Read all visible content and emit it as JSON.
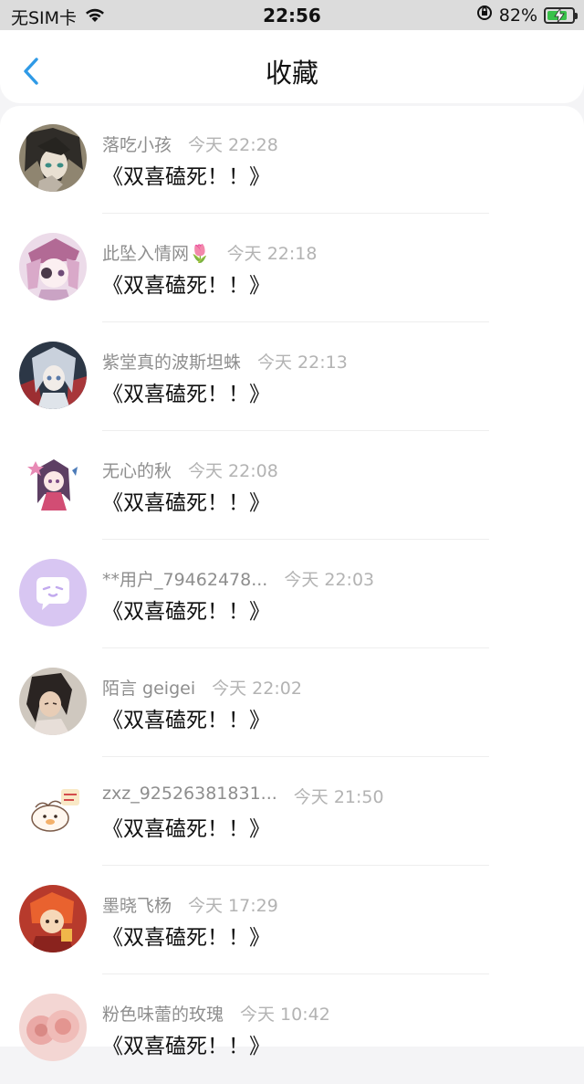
{
  "status_bar": {
    "carrier": "无SIM卡",
    "time": "22:56",
    "battery": "82%",
    "battery_level": 0.82
  },
  "nav": {
    "title": "收藏"
  },
  "items": [
    {
      "name": "落吃小孩",
      "time": "今天 22:28",
      "comment": "《双喜磕死！！》"
    },
    {
      "name": "此坠入情网🌷",
      "time": "今天 22:18",
      "comment": "《双喜磕死！！》"
    },
    {
      "name": "紫堂真的波斯坦蛛",
      "time": "今天 22:13",
      "comment": "《双喜磕死！！》"
    },
    {
      "name": "无心的秋",
      "time": "今天 22:08",
      "comment": "《双喜磕死！！》"
    },
    {
      "name": "**用户_79462478...",
      "time": "今天 22:03",
      "comment": "《双喜磕死！！》"
    },
    {
      "name": "陌言 geigei",
      "time": "今天 22:02",
      "comment": "《双喜磕死！！》"
    },
    {
      "name": "zxz_92526381831...",
      "time": "今天 21:50",
      "comment": "《双喜磕死！！》"
    },
    {
      "name": "墨晓飞杨",
      "time": "今天 17:29",
      "comment": "《双喜磕死！！》"
    },
    {
      "name": "粉色味蕾的玫瑰",
      "time": "今天 10:42",
      "comment": "《双喜磕死！！》"
    }
  ]
}
